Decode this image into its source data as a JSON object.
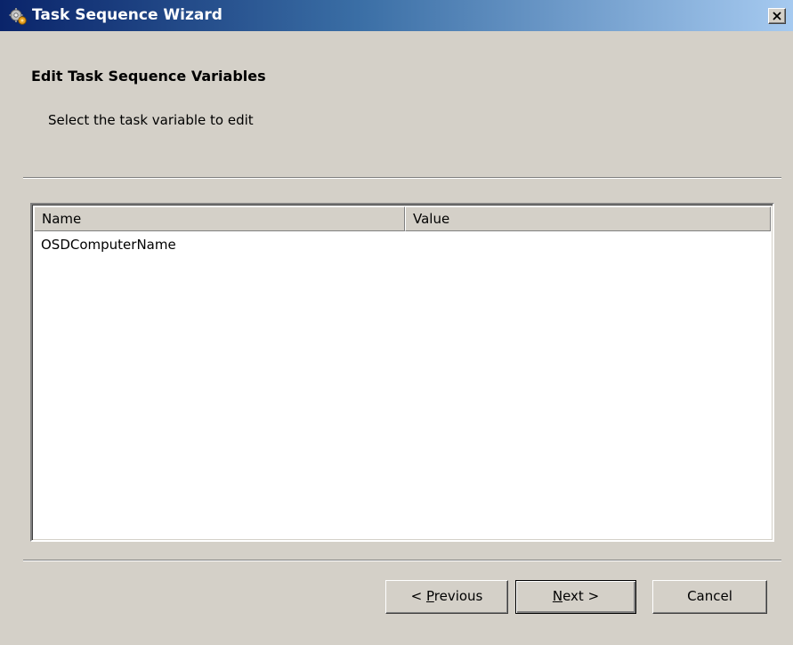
{
  "window": {
    "title": "Task Sequence Wizard"
  },
  "page": {
    "heading": "Edit Task Sequence Variables",
    "subheading": "Select the task variable to edit"
  },
  "list": {
    "columns": [
      "Name",
      "Value"
    ],
    "rows": [
      {
        "name": "OSDComputerName",
        "value": ""
      }
    ]
  },
  "buttons": {
    "previous_prefix": "< ",
    "previous_accel": "P",
    "previous_rest": "revious",
    "next_accel": "N",
    "next_rest": "ext >",
    "cancel": "Cancel"
  },
  "icons": {
    "title_icon": "task-sequence-gear-icon",
    "close_icon": "close-icon"
  }
}
